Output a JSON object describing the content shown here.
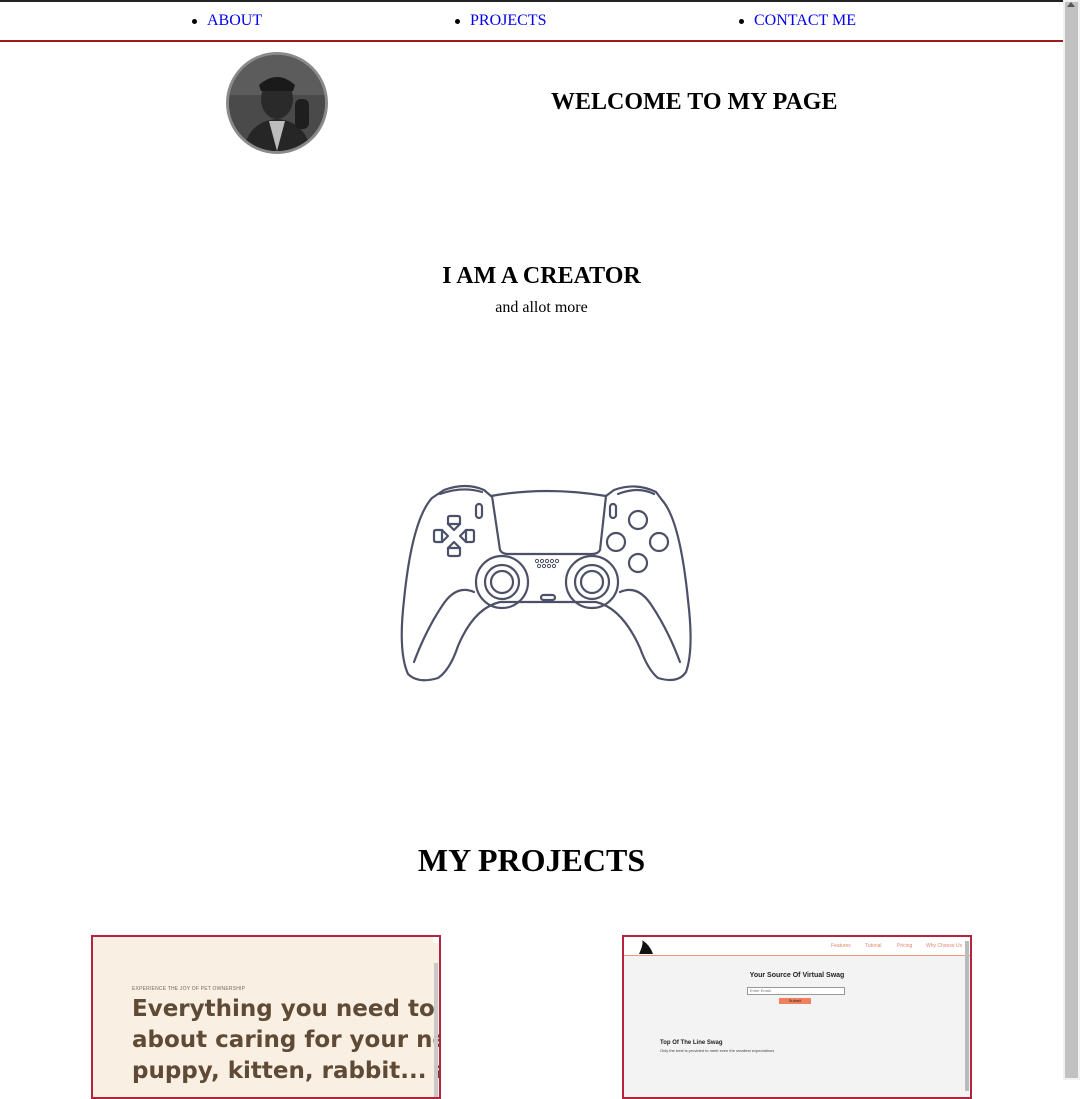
{
  "nav": {
    "items": [
      {
        "label": "ABOUT"
      },
      {
        "label": "PROJECTS"
      },
      {
        "label": "CONTACT ME"
      }
    ],
    "border_color": "#9b1b1b",
    "link_color": "#0000ee"
  },
  "header": {
    "welcome": "WELCOME TO MY PAGE"
  },
  "hero": {
    "title": "I AM A CREATOR",
    "subtitle": "and allot more",
    "icon": "gamepad-icon"
  },
  "projects": {
    "title": "MY PROJECTS",
    "cards": [
      {
        "kicker": "EXPERIENCE THE JOY OF PET OWNERSHIP",
        "headline_lines": [
          "Everything you need to know",
          "about caring for your new",
          "puppy, kitten, rabbit... and"
        ],
        "background": "#f9efe2",
        "headline_color": "#5f4a36"
      },
      {
        "nav_links": [
          "Features",
          "Tutorial",
          "Pricing",
          "Why Choose Us"
        ],
        "hero": "Your Source Of Virtual Swag",
        "email_placeholder": "Enter Email",
        "submit_label": "Submit",
        "section_title": "Top Of The Line Swag",
        "section_text": "Only the best is provided to meet even the smallest expectations",
        "accent": "#f0805e"
      }
    ],
    "card_border_color": "#b3243e"
  }
}
